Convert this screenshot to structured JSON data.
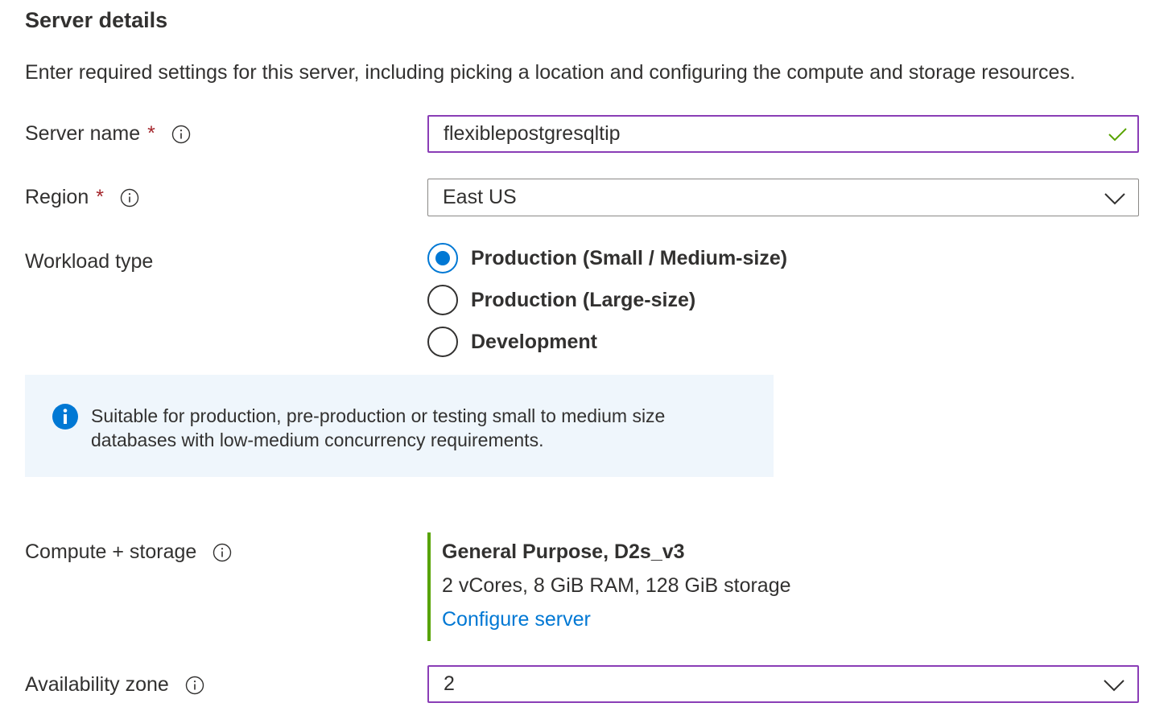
{
  "section": {
    "title": "Server details",
    "description": "Enter required settings for this server, including picking a location and configuring the compute and storage resources."
  },
  "fields": {
    "server_name": {
      "label": "Server name",
      "required_marker": "*",
      "value": "flexiblepostgresqltip",
      "valid": true
    },
    "region": {
      "label": "Region",
      "required_marker": "*",
      "value": "East US"
    },
    "workload_type": {
      "label": "Workload type",
      "options": [
        {
          "label": "Production (Small / Medium-size)",
          "selected": true
        },
        {
          "label": "Production (Large-size)",
          "selected": false
        },
        {
          "label": "Development",
          "selected": false
        }
      ]
    },
    "info_message": "Suitable for production, pre-production or testing small to medium size databases with low-medium concurrency requirements.",
    "compute_storage": {
      "label": "Compute + storage",
      "tier": "General Purpose, D2s_v3",
      "spec": "2 vCores, 8 GiB RAM, 128 GiB storage",
      "link": "Configure server"
    },
    "availability_zone": {
      "label": "Availability zone",
      "value": "2"
    }
  },
  "icons": {
    "info": "info-icon",
    "valid": "checkmark-icon",
    "dropdown": "chevron-down-icon",
    "infobar": "info-filled-icon"
  },
  "colors": {
    "accent": "#0078d4",
    "focus_border": "#8a3db6",
    "required": "#a4262c",
    "valid_check": "#57a300",
    "compute_bar": "#57a300",
    "infobar_bg": "#eff6fc"
  }
}
